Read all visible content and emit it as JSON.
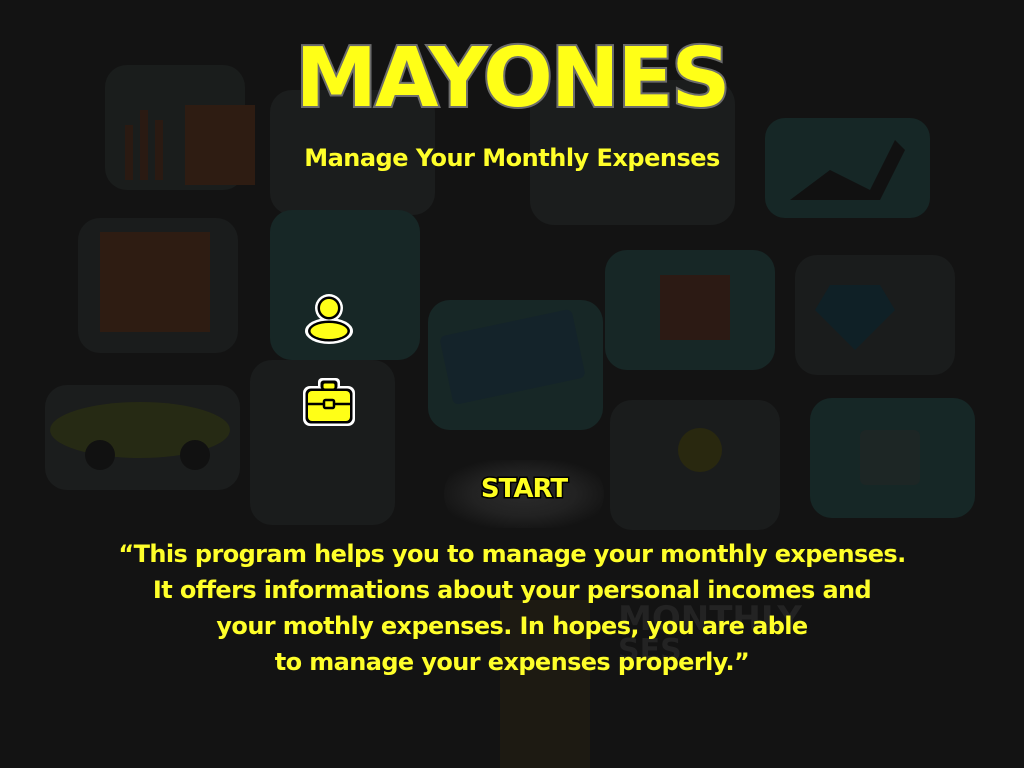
{
  "app": {
    "title": "MAYONES",
    "subtitle": "Manage Your Monthly Expenses"
  },
  "buttons": {
    "user_icon": "user-icon",
    "job_icon": "briefcase-icon",
    "start_label": "START"
  },
  "description": {
    "lines": [
      "“This program helps you to manage your monthly expenses.",
      "It offers informations about your personal incomes and",
      "your mothly expenses. In hopes, you are able",
      "to manage your expenses properly.”"
    ]
  },
  "background": {
    "watermark_text": "MONTHLY EXPENSES"
  },
  "colors": {
    "accent": "#FFFF17",
    "background": "#131313",
    "title_outline": "#6C6C6C"
  }
}
